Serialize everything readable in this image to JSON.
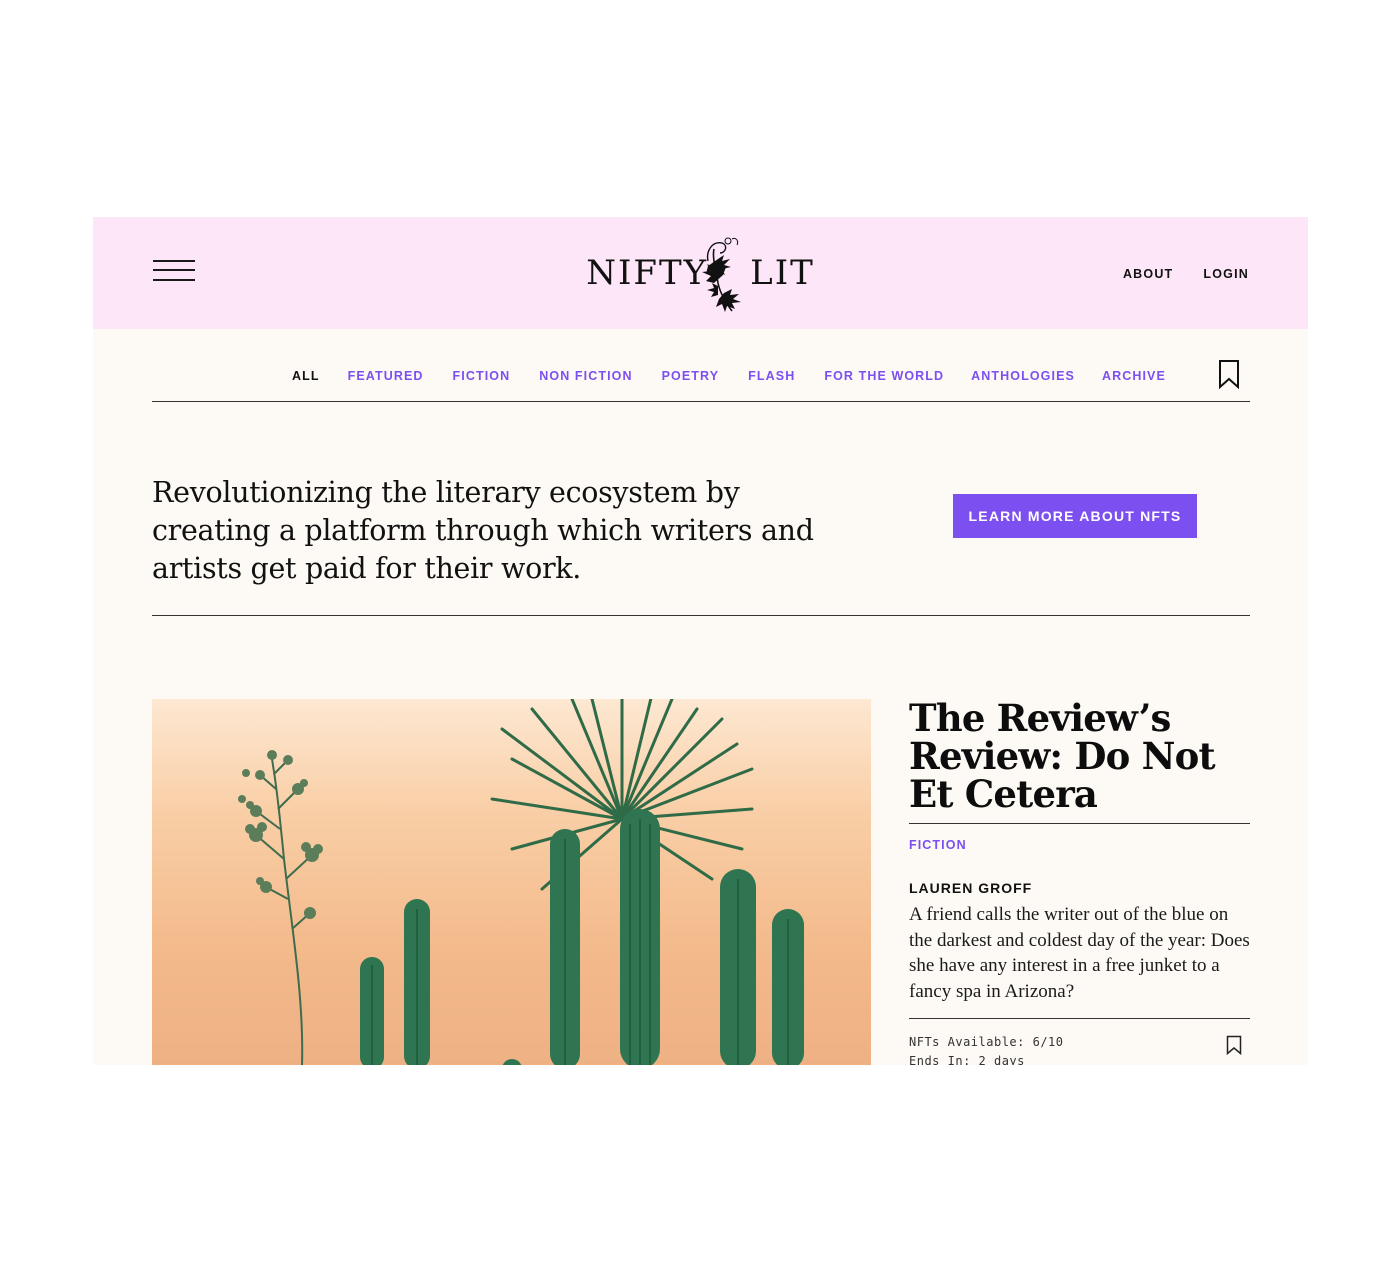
{
  "header": {
    "logo": {
      "left": "NIFTY",
      "right": "LIT"
    },
    "links": [
      "ABOUT",
      "LOGIN"
    ]
  },
  "nav": {
    "items": [
      "ALL",
      "FEATURED",
      "FICTION",
      "NON FICTION",
      "POETRY",
      "FLASH",
      "FOR THE WORLD",
      "ANTHOLOGIES",
      "ARCHIVE"
    ],
    "active": "ALL"
  },
  "hero": {
    "text": "Revolutionizing the literary ecosystem by creating a platform through which writers and artists get paid for their work.",
    "cta": "LEARN MORE ABOUT NFTS"
  },
  "featured": {
    "title": "The Review’s Review: Do Not Et Cetera",
    "category": "FICTION",
    "author": "LAUREN GROFF",
    "blurb": "A friend calls the writer out of the blue on the darkest and coldest day of the year: Does she have any interest in a free junket to a fancy spa in Arizona?",
    "nfts_available": "NFTs Available: 6/10",
    "ends_in": "Ends In: 2 days"
  },
  "colors": {
    "header_bg": "#fde6f7",
    "page_bg": "#fdf9f4",
    "accent": "#7b4ff0",
    "text": "#111111"
  }
}
